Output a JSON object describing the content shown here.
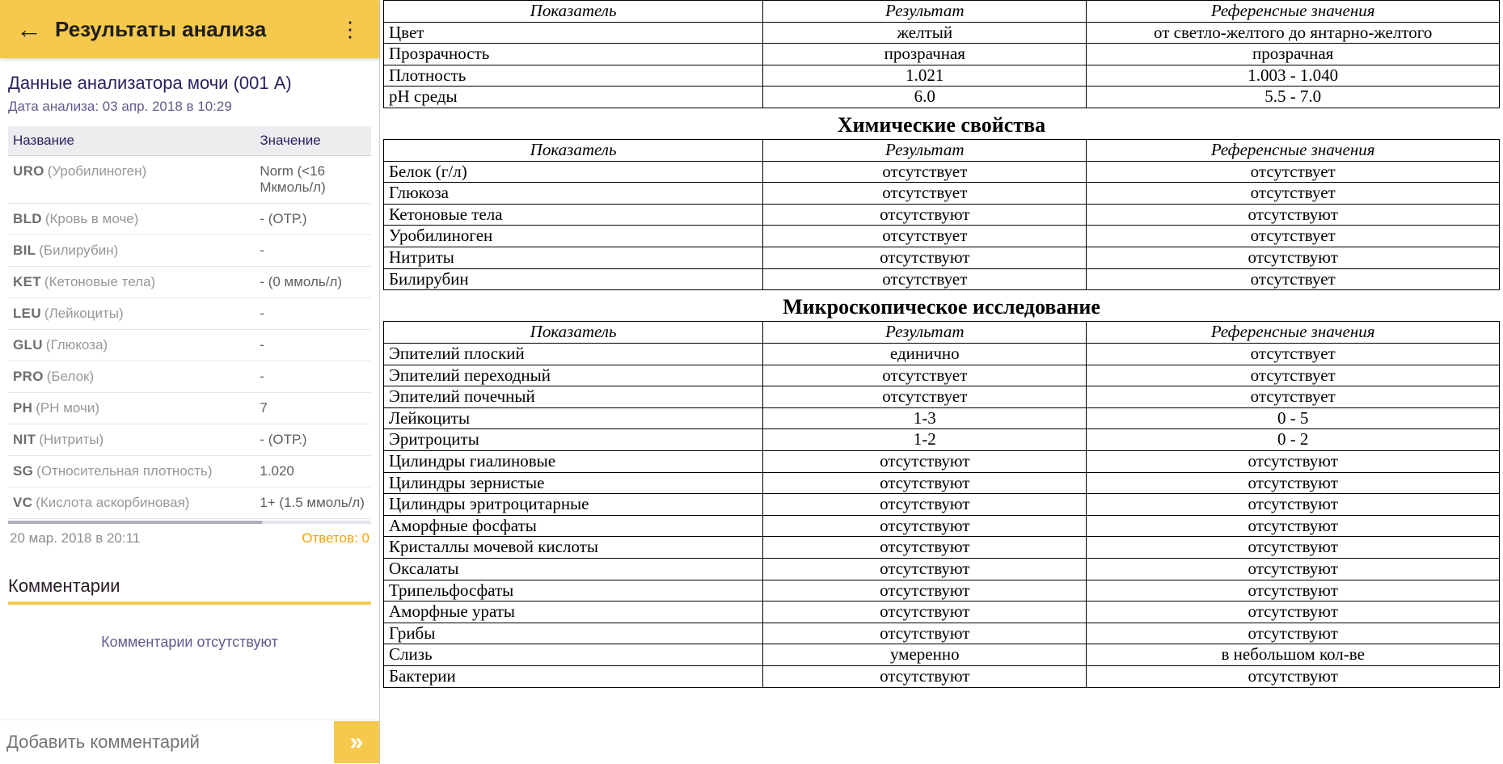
{
  "app": {
    "toolbar_title": "Результаты анализа",
    "subtitle": "Данные анализатора мочи (001 A)",
    "date_line": "Дата анализа: 03 апр. 2018 в 10:29",
    "table_headers": {
      "name": "Название",
      "value": "Значение"
    },
    "rows": [
      {
        "code": "URO",
        "name": "(Уробилиноген)",
        "value": "Norm (<16 Мкмоль/л)"
      },
      {
        "code": "BLD",
        "name": "(Кровь в моче)",
        "value": "- (ОТР.)"
      },
      {
        "code": "BIL",
        "name": "(Билирубин)",
        "value": "-"
      },
      {
        "code": "KET",
        "name": "(Кетоновые тела)",
        "value": "- (0 ммоль/л)"
      },
      {
        "code": "LEU",
        "name": "(Лейкоциты)",
        "value": "-"
      },
      {
        "code": "GLU",
        "name": "(Глюкоза)",
        "value": "-"
      },
      {
        "code": "PRO",
        "name": "(Белок)",
        "value": "-"
      },
      {
        "code": "PH",
        "name": "(PH мочи)",
        "value": "7"
      },
      {
        "code": "NIT",
        "name": "(Нитриты)",
        "value": "- (ОТР.)"
      },
      {
        "code": "SG",
        "name": "(Относительная плотность)",
        "value": "1.020"
      },
      {
        "code": "VC",
        "name": "(Кислота аскорбиновая)",
        "value": "1+ (1.5 ммоль/л)"
      }
    ],
    "footer_date": "20 мар. 2018 в 20:11",
    "answers_label": "Ответов: 0",
    "comments_heading": "Комментарии",
    "no_comments": "Комментарии отсутствуют",
    "add_comment_placeholder": "Добавить комментарий"
  },
  "doc": {
    "headers": {
      "param": "Показатель",
      "result": "Результат",
      "ref": "Референсные значения"
    },
    "t1": [
      {
        "p": "Цвет",
        "r": "желтый",
        "ref": "от светло-желтого до янтарно-желтого"
      },
      {
        "p": "Прозрачность",
        "r": "прозрачная",
        "ref": "прозрачная"
      },
      {
        "p": "Плотность",
        "r": "1.021",
        "ref": "1.003 - 1.040"
      },
      {
        "p": "pH среды",
        "r": "6.0",
        "ref": "5.5 - 7.0"
      }
    ],
    "section2": "Химические свойства",
    "t2": [
      {
        "p": "Белок (г/л)",
        "r": "отсутствует",
        "ref": "отсутствует"
      },
      {
        "p": "Глюкоза",
        "r": "отсутствует",
        "ref": "отсутствует"
      },
      {
        "p": "Кетоновые тела",
        "r": "отсутствуют",
        "ref": "отсутствуют"
      },
      {
        "p": "Уробилиноген",
        "r": "отсутствует",
        "ref": "отсутствует"
      },
      {
        "p": "Нитриты",
        "r": "отсутствуют",
        "ref": "отсутствуют"
      },
      {
        "p": "Билирубин",
        "r": "отсутствует",
        "ref": "отсутствует"
      }
    ],
    "section3": "Микроскопическое исследование",
    "t3": [
      {
        "p": "Эпителий плоский",
        "r": "единично",
        "ref": "отсутствует"
      },
      {
        "p": "Эпителий переходный",
        "r": "отсутствует",
        "ref": "отсутствует"
      },
      {
        "p": "Эпителий почечный",
        "r": "отсутствует",
        "ref": "отсутствует"
      },
      {
        "p": "Лейкоциты",
        "r": "1-3",
        "ref": "0 - 5"
      },
      {
        "p": "Эритроциты",
        "r": "1-2",
        "ref": "0 - 2"
      },
      {
        "p": "Цилиндры гиалиновые",
        "r": "отсутствуют",
        "ref": "отсутствуют"
      },
      {
        "p": "Цилиндры зернистые",
        "r": "отсутствуют",
        "ref": "отсутствуют"
      },
      {
        "p": "Цилиндры эритроцитарные",
        "r": "отсутствуют",
        "ref": "отсутствуют"
      },
      {
        "p": "Аморфные фосфаты",
        "r": "отсутствуют",
        "ref": "отсутствуют"
      },
      {
        "p": "Кристаллы мочевой кислоты",
        "r": "отсутствуют",
        "ref": "отсутствуют"
      },
      {
        "p": "Оксалаты",
        "r": "отсутствуют",
        "ref": "отсутствуют"
      },
      {
        "p": "Трипельфосфаты",
        "r": "отсутствуют",
        "ref": "отсутствуют"
      },
      {
        "p": "Аморфные ураты",
        "r": "отсутствуют",
        "ref": "отсутствуют"
      },
      {
        "p": "Грибы",
        "r": "отсутствуют",
        "ref": "отсутствуют"
      },
      {
        "p": "Слизь",
        "r": "умеренно",
        "ref": "в небольшом кол-ве"
      },
      {
        "p": "Бактерии",
        "r": "отсутствуют",
        "ref": "отсутствуют"
      }
    ]
  }
}
